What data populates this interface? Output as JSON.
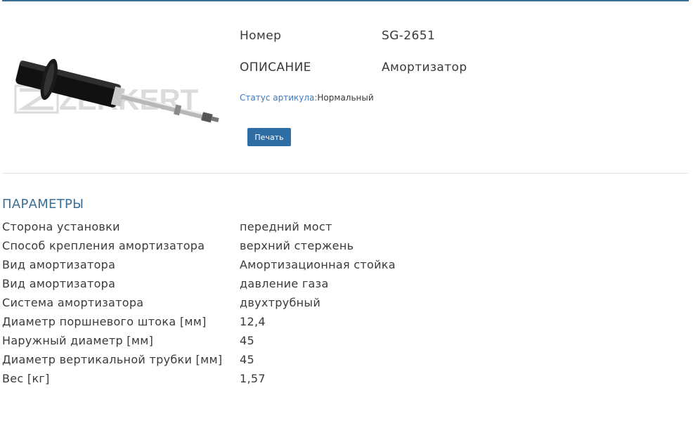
{
  "product": {
    "number_label": "Номер",
    "number_value": "SG-2651",
    "description_label": "ОПИСАНИЕ",
    "description_value": "Амортизатор",
    "status_label": "Статус артикула:",
    "status_value": "Нормальный",
    "print_button": "Печать",
    "brand_logo_text": "ZEKKERT"
  },
  "parameters": {
    "title": "ПАРАМЕТРЫ",
    "rows": [
      {
        "name": "Сторона установки",
        "value": "передний мост"
      },
      {
        "name": "Способ крепления амортизатора",
        "value": "верхний стержень"
      },
      {
        "name": "Вид амортизатора",
        "value": "Амортизационная стойка"
      },
      {
        "name": "Вид амортизатора",
        "value": "давление газа"
      },
      {
        "name": "Система амортизатора",
        "value": "двухтрубный"
      },
      {
        "name": "Диаметр поршневого штока [мм]",
        "value": "12,4"
      },
      {
        "name": "Наружный диаметр [мм]",
        "value": "45"
      },
      {
        "name": "Диаметр вертикальной трубки [мм]",
        "value": "45"
      },
      {
        "name": "Вес [кг]",
        "value": "1,57"
      }
    ]
  },
  "colors": {
    "accent": "#3a6f97",
    "button": "#2f6ea5",
    "status_label": "#3a7bbf"
  }
}
